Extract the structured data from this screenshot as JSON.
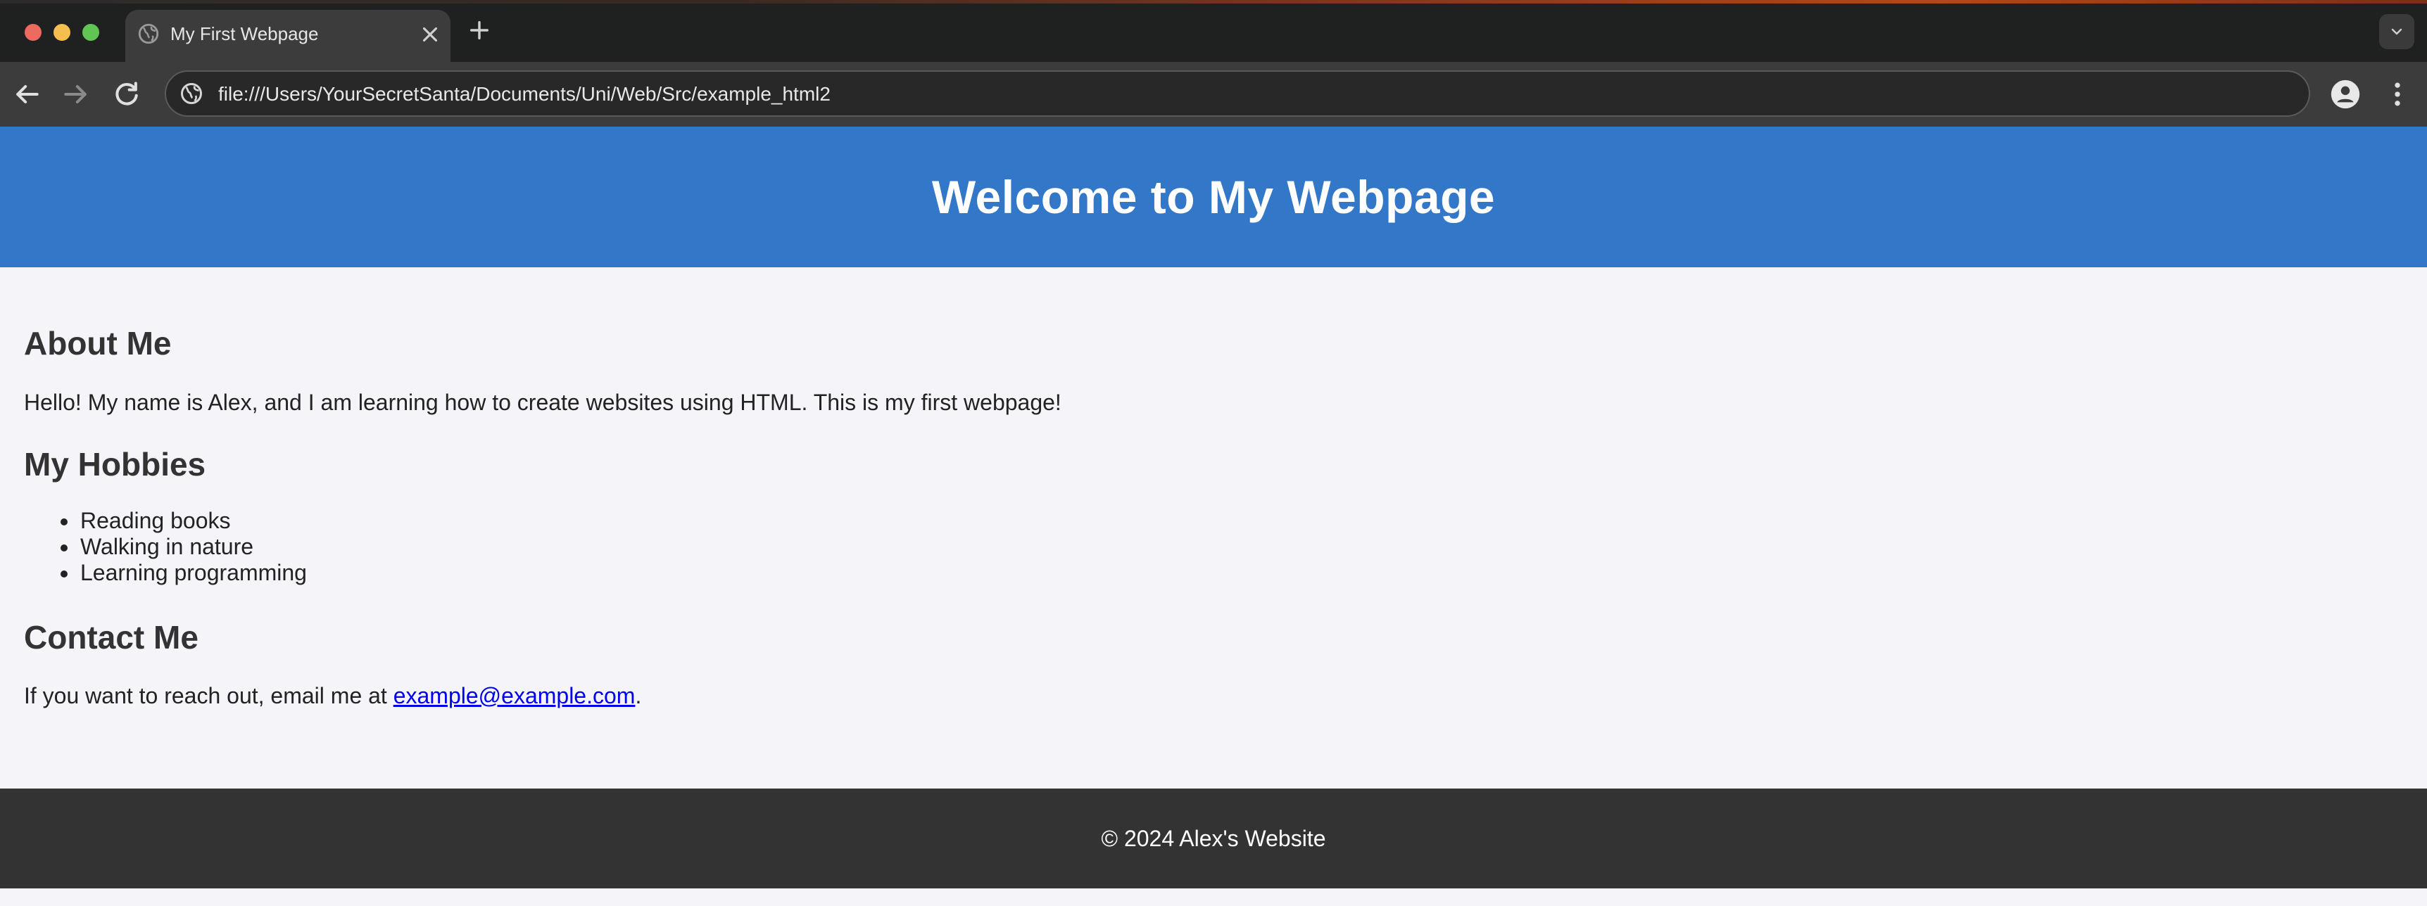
{
  "browser": {
    "tab": {
      "title": "My First Webpage"
    },
    "address_bar": {
      "url": "file:///Users/YourSecretSanta/Documents/Uni/Web/Src/example_html2"
    },
    "icons": {
      "tab_favicon": "globe-icon",
      "tab_close": "close-icon",
      "new_tab": "plus-icon",
      "tab_search": "chevron-down-icon",
      "back": "arrow-left-icon",
      "forward": "arrow-right-icon",
      "reload": "reload-icon",
      "site_info": "globe-icon",
      "profile": "profile-icon",
      "menu": "kebab-menu-icon"
    }
  },
  "page": {
    "header": {
      "title": "Welcome to My Webpage"
    },
    "about": {
      "heading": "About Me",
      "text": "Hello! My name is Alex, and I am learning how to create websites using HTML. This is my first webpage!"
    },
    "hobbies": {
      "heading": "My Hobbies",
      "items": [
        "Reading books",
        "Walking in nature",
        "Learning programming"
      ]
    },
    "contact": {
      "heading": "Contact Me",
      "text_before": "If you want to reach out, email me at ",
      "email": "example@example.com",
      "text_after": "."
    },
    "footer": {
      "text": "© 2024 Alex's Website"
    }
  },
  "colors": {
    "header_bg": "#3377c9",
    "page_bg": "#f4f4f9",
    "footer_bg": "#333333",
    "link": "#0000ee"
  }
}
